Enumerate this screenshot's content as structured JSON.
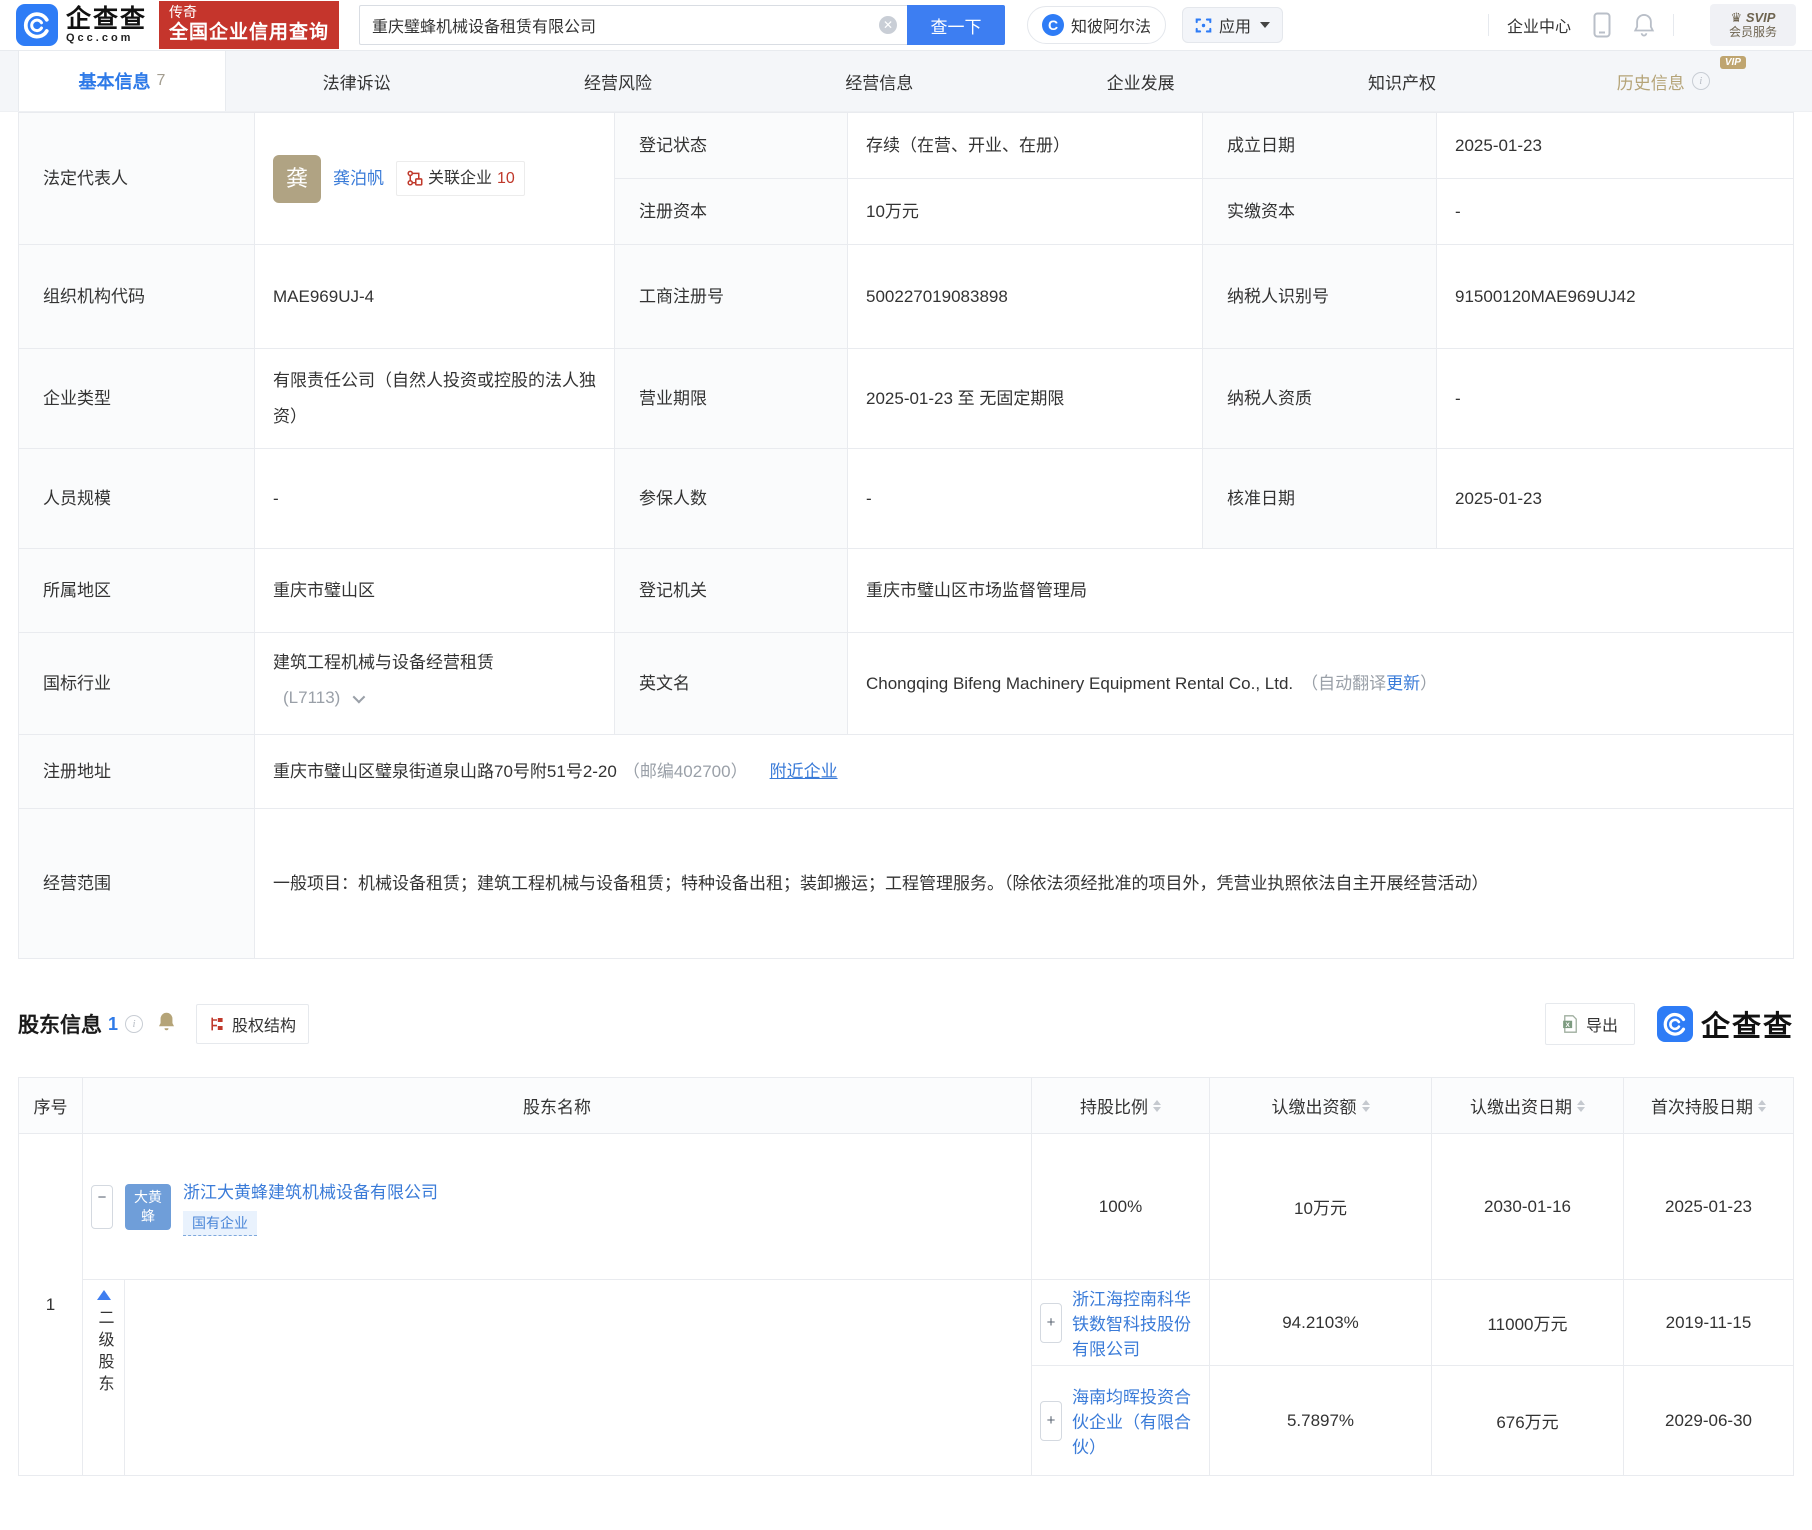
{
  "colors": {
    "brand_blue": "#2e7cf6",
    "brand_red": "#c5352c",
    "link_blue": "#3a7bd8",
    "accent_tan": "#b5a478",
    "status_red": "#c0392b"
  },
  "header": {
    "brand": "企查查",
    "brand_sub": "Qcc.com",
    "promo_top": "传奇",
    "promo_main": "全国企业信用查询",
    "search_value": "重庆璧蜂机械设备租赁有限公司",
    "search_btn": "查一下",
    "nav_zhibi": "知彼阿尔法",
    "nav_apps": "应用",
    "nav_center": "企业中心",
    "svip_top": "SVIP",
    "svip_sub": "会员服务"
  },
  "tabs": [
    {
      "label": "基本信息",
      "count": "7"
    },
    {
      "label": "法律诉讼"
    },
    {
      "label": "经营风险"
    },
    {
      "label": "经营信息"
    },
    {
      "label": "企业发展"
    },
    {
      "label": "知识产权"
    },
    {
      "label": "历史信息",
      "vip": "VIP"
    }
  ],
  "info": {
    "legal_rep": {
      "label": "法定代表人",
      "avatar": "龚",
      "name": "龚泊帆",
      "related_label": "关联企业",
      "related_count": "10"
    },
    "reg_status": {
      "label": "登记状态",
      "value": "存续（在营、开业、在册）"
    },
    "establish_date": {
      "label": "成立日期",
      "value": "2025-01-23"
    },
    "reg_capital": {
      "label": "注册资本",
      "value": "10万元"
    },
    "paid_capital": {
      "label": "实缴资本",
      "value": "-"
    },
    "org_code": {
      "label": "组织机构代码",
      "value": "MAE969UJ-4"
    },
    "biz_reg_no": {
      "label": "工商注册号",
      "value": "500227019083898"
    },
    "taxpayer_id": {
      "label": "纳税人识别号",
      "value": "91500120MAE969UJ42"
    },
    "company_type": {
      "label": "企业类型",
      "value": "有限责任公司（自然人投资或控股的法人独资）"
    },
    "biz_term": {
      "label": "营业期限",
      "value": "2025-01-23 至 无固定期限"
    },
    "taxpayer_quality": {
      "label": "纳税人资质",
      "value": "-"
    },
    "staff_size": {
      "label": "人员规模",
      "value": "-"
    },
    "insured_count": {
      "label": "参保人数",
      "value": "-"
    },
    "approval_date": {
      "label": "核准日期",
      "value": "2025-01-23"
    },
    "region": {
      "label": "所属地区",
      "value": "重庆市璧山区"
    },
    "reg_authority": {
      "label": "登记机关",
      "value": "重庆市璧山区市场监督管理局"
    },
    "industry": {
      "label": "国标行业",
      "value": "建筑工程机械与设备经营租赁",
      "code": "(L7113)"
    },
    "english_name": {
      "label": "英文名",
      "value": "Chongqing Bifeng Machinery Equipment Rental Co., Ltd.",
      "note_prefix": "（自动翻译",
      "note_link": "更新",
      "note_suffix": "）"
    },
    "reg_address": {
      "label": "注册地址",
      "value": "重庆市璧山区璧泉街道泉山路70号附51号2-20",
      "postcode": "（邮编402700）",
      "nearby_link": "附近企业"
    },
    "business_scope": {
      "label": "经营范围",
      "value": "一般项目：机械设备租赁；建筑工程机械与设备租赁；特种设备出租；装卸搬运；工程管理服务。（除依法须经批准的项目外，凭营业执照依法自主开展经营活动）"
    }
  },
  "shareholders": {
    "section_title": "股东信息",
    "section_count": "1",
    "equity_structure_btn": "股权结构",
    "export_btn": "导出",
    "brand": "企查查",
    "columns": {
      "seq": "序号",
      "name": "股东名称",
      "ratio": "持股比例",
      "amount": "认缴出资额",
      "date": "认缴出资日期",
      "first_date": "首次持股日期"
    },
    "row_no": "1",
    "main": {
      "avatar": "大黄蜂",
      "name": "浙江大黄蜂建筑机械设备有限公司",
      "tag": "国有企业",
      "ratio": "100%",
      "amount": "10万元",
      "date": "2030-01-16",
      "first_date": "2025-01-23"
    },
    "sub_group_label": "二级股东",
    "subs": [
      {
        "name": "浙江海控南科华铁数智科技股份有限公司",
        "ratio": "94.2103%",
        "amount": "11000万元",
        "date": "2019-11-15"
      },
      {
        "name": "海南均晖投资合伙企业（有限合伙）",
        "ratio": "5.7897%",
        "amount": "676万元",
        "date": "2029-06-30"
      }
    ]
  }
}
